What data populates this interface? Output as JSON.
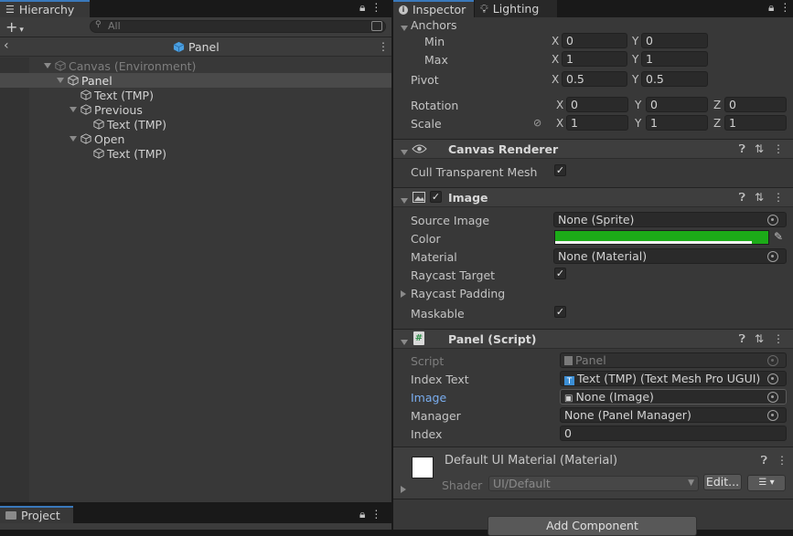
{
  "hierarchy": {
    "tab_label": "Hierarchy",
    "search_placeholder": "All",
    "scene_header": "Panel",
    "items": [
      {
        "label": "Canvas (Environment)"
      },
      {
        "label": "Panel"
      },
      {
        "label": "Text (TMP)"
      },
      {
        "label": "Previous"
      },
      {
        "label": "Text (TMP)"
      },
      {
        "label": "Open"
      },
      {
        "label": "Text (TMP)"
      }
    ]
  },
  "project": {
    "tab_label": "Project"
  },
  "inspector": {
    "tabs": [
      {
        "label": "Inspector"
      },
      {
        "label": "Lighting"
      }
    ],
    "rect_transform": {
      "anchors_label": "Anchors",
      "min_label": "Min",
      "min_x": "0",
      "min_y": "0",
      "max_label": "Max",
      "max_x": "1",
      "max_y": "1",
      "pivot_label": "Pivot",
      "pivot_x": "0.5",
      "pivot_y": "0.5",
      "rotation_label": "Rotation",
      "rot_x": "0",
      "rot_y": "0",
      "rot_z": "0",
      "scale_label": "Scale",
      "scale_x": "1",
      "scale_y": "1",
      "scale_z": "1",
      "axis_x": "X",
      "axis_y": "Y",
      "axis_z": "Z"
    },
    "canvas_renderer": {
      "title": "Canvas Renderer",
      "cull_label": "Cull Transparent Mesh",
      "cull_checked": true
    },
    "image": {
      "title": "Image",
      "source_label": "Source Image",
      "source_value": "None (Sprite)",
      "color_label": "Color",
      "color_value": "#1cab18",
      "material_label": "Material",
      "material_value": "None (Material)",
      "raycast_label": "Raycast Target",
      "padding_label": "Raycast Padding",
      "maskable_label": "Maskable"
    },
    "panel_script": {
      "title": "Panel (Script)",
      "script_label": "Script",
      "script_value": "Panel",
      "index_text_label": "Index Text",
      "index_text_value": "Text (TMP) (Text Mesh Pro UGUI)",
      "image_label": "Image",
      "image_value": "None (Image)",
      "manager_label": "Manager",
      "manager_value": "None (Panel Manager)",
      "index_label": "Index",
      "index_value": "0"
    },
    "material": {
      "title": "Default UI Material (Material)",
      "shader_label": "Shader",
      "shader_value": "UI/Default",
      "edit_label": "Edit..."
    },
    "add_component_label": "Add Component"
  }
}
